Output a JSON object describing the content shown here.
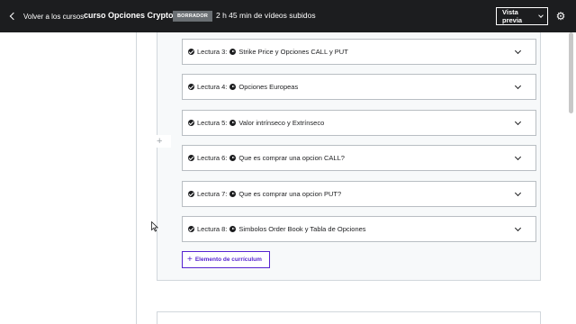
{
  "topbar": {
    "back_label": "Volver a los cursos",
    "course_title": "curso Opciones Crypto",
    "status_badge": "BORRADOR",
    "video_info": "2 h 45 min de vídeos subidos",
    "preview_label": "Vista previa",
    "settings_icon": "gear-icon"
  },
  "lectures": [
    {
      "number": "Lectura 3:",
      "title": "Strike Price y Opciones CALL y PUT"
    },
    {
      "number": "Lectura 4:",
      "title": "Opciones Europeas"
    },
    {
      "number": "Lectura 5:",
      "title": "Valor intrínseco y Extrínseco"
    },
    {
      "number": "Lectura 6:",
      "title": "Que es comprar una opcion CALL?"
    },
    {
      "number": "Lectura 7:",
      "title": "Que es comprar una opcion PUT?"
    },
    {
      "number": "Lectura 8:",
      "title": "Simbolos Order Book y Tabla de Opciones"
    }
  ],
  "add_item": {
    "label": "Elemento de currículum"
  },
  "colors": {
    "topbar_bg": "#1c1d1f",
    "accent": "#5624d0",
    "section_bg": "#f7f9fa",
    "badge_bg": "#6a6f73"
  },
  "icons": {
    "lecture_status": "check-circle-icon",
    "lecture_type": "play-circle-icon",
    "expand": "chevron-down-icon",
    "add": "plus-icon"
  }
}
